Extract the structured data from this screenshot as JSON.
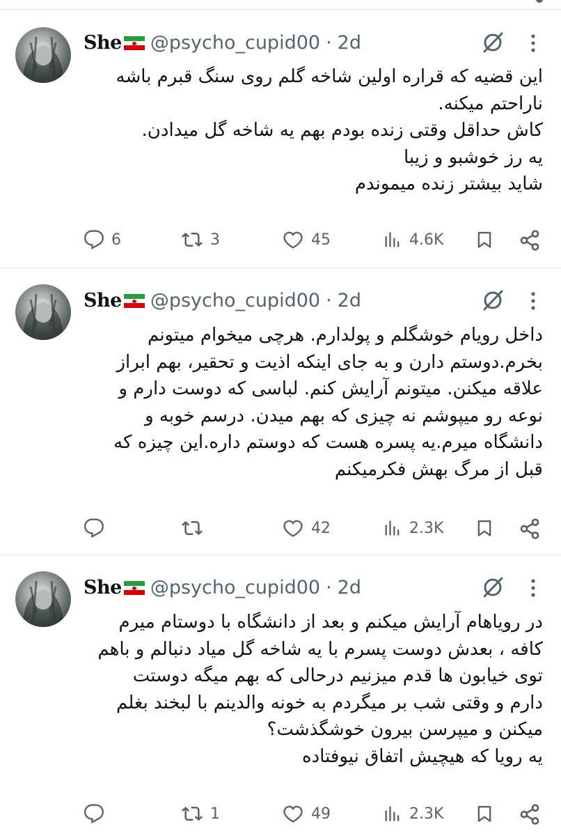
{
  "tweets": [
    {
      "author_name": "She",
      "handle": "@psycho_cupid00",
      "separator": "·",
      "time": "2d",
      "lines": [
        "این قضیه که قراره اولین شاخه گلم روی سنگ قبرم باشه",
        "ناراحتم میکنه.",
        "کاش حداقل وقتی زنده بودم بهم یه شاخه گل میدادن.",
        "یه رز خوشبو و زیبا",
        "شاید بیشتر زنده میموندم"
      ],
      "replies": "6",
      "reposts": "3",
      "likes": "45",
      "views": "4.6K"
    },
    {
      "author_name": "She",
      "handle": "@psycho_cupid00",
      "separator": "·",
      "time": "2d",
      "lines": [
        "داخل رویام خوشگلم و پولدارم. هرچی میخوام میتونم",
        "بخرم.دوستم دارن و به جای اینکه اذیت و تحقیر، بهم ابراز",
        "علاقه میکنن. میتونم آرایش کنم. لباسی که دوست دارم و",
        "نوعه رو میپوشم نه چیزی که بهم میدن. درسم خوبه و",
        "دانشگاه میرم.یه پسره هست که دوستم داره.این چیزه که",
        "قبل از مرگ بهش فکرمیکنم"
      ],
      "replies": "",
      "reposts": "",
      "likes": "42",
      "views": "2.3K"
    },
    {
      "author_name": "She",
      "handle": "@psycho_cupid00",
      "separator": "·",
      "time": "2d",
      "lines": [
        "در رویاهام آرایش میکنم و بعد از دانشگاه با دوستام میرم",
        "کافه ، بعدش دوست پسرم با یه شاخه گل میاد دنبالم و باهم",
        "توی خیابون ها قدم میزنیم درحالی که بهم میگه دوستت",
        "دارم و وقتی  شب بر میگردم به خونه والدینم با لبخند بغلم",
        "میکنن و میپرسن بیرون خوشگذشت؟",
        "یه رویا که هیچیش اتفاق نیوفتاده"
      ],
      "replies": "",
      "reposts": "1",
      "likes": "49",
      "views": "2.3K"
    }
  ],
  "icons": {
    "reply": "reply-icon",
    "repost": "repost-icon",
    "like": "heart-icon",
    "views": "views-icon",
    "bookmark": "bookmark-icon",
    "share": "share-icon",
    "grok": "grok-icon",
    "more": "more-icon"
  },
  "colors": {
    "text": "#0f1419",
    "secondary": "#536471",
    "divider": "#e6e9ec",
    "flag_green": "#239f40",
    "flag_red": "#da0000"
  }
}
